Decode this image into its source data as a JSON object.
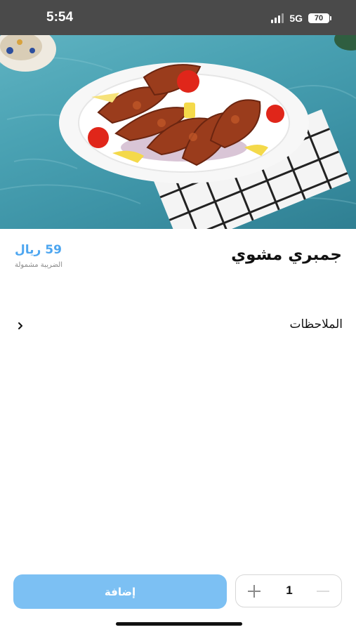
{
  "status_bar": {
    "time": "5:54",
    "network": "5G",
    "battery": "70"
  },
  "hero": {
    "image_description_icon": "grilled-shrimp-plate-image"
  },
  "product": {
    "title": "جمبري مشوي",
    "price": "59 ريال",
    "tax_note": "الضريبة مشمولة"
  },
  "notes": {
    "label": "الملاحظات"
  },
  "bottom_bar": {
    "add_label": "إضافة",
    "quantity": "1"
  },
  "colors": {
    "accent": "#4da6f0",
    "add_button": "#7cc0f3",
    "status_bar": "#4a4a4a"
  }
}
